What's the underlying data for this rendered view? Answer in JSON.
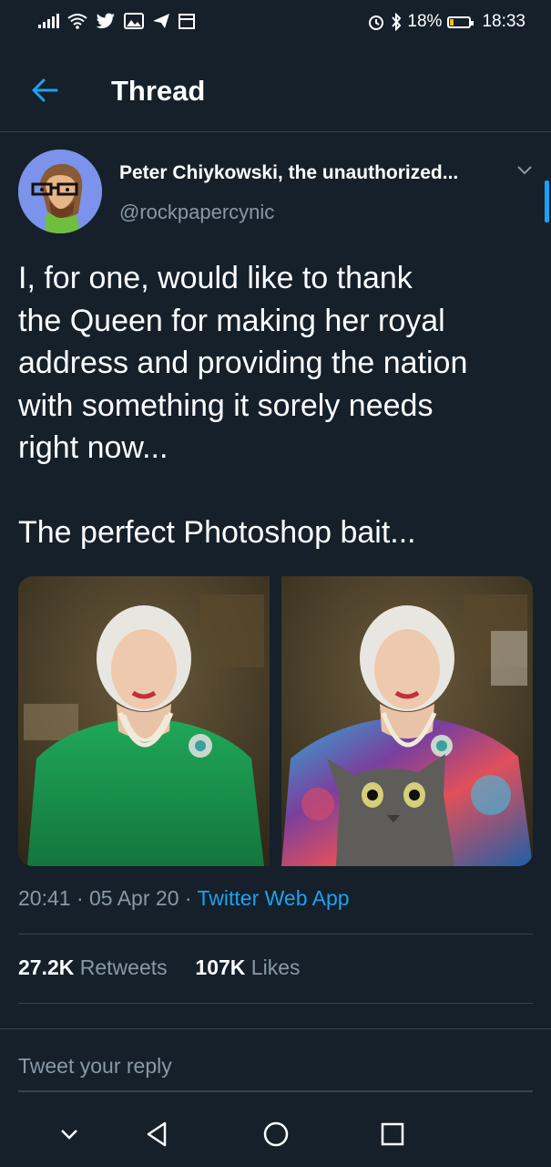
{
  "status_bar": {
    "battery": "18%",
    "time": "18:33"
  },
  "header": {
    "title": "Thread"
  },
  "tweet": {
    "author_name": "Peter Chiykowski, the unauthorized...",
    "handle": "@rockpapercynic",
    "text": "I, for one, would like to thank\nthe Queen for making her royal\naddress and providing the nation\nwith something it sorely needs\nright now...\n\nThe perfect Photoshop bait...",
    "time": "20:41",
    "date": "05 Apr 20",
    "source": "Twitter Web App",
    "retweets_count": "27.2K",
    "retweets_label": "Retweets",
    "likes_count": "107K",
    "likes_label": "Likes"
  },
  "reply": {
    "placeholder": "Tweet your reply"
  },
  "colors": {
    "background": "#15202b",
    "accent": "#1da1f2",
    "secondary_text": "#8899a6",
    "divider": "#38444d"
  }
}
